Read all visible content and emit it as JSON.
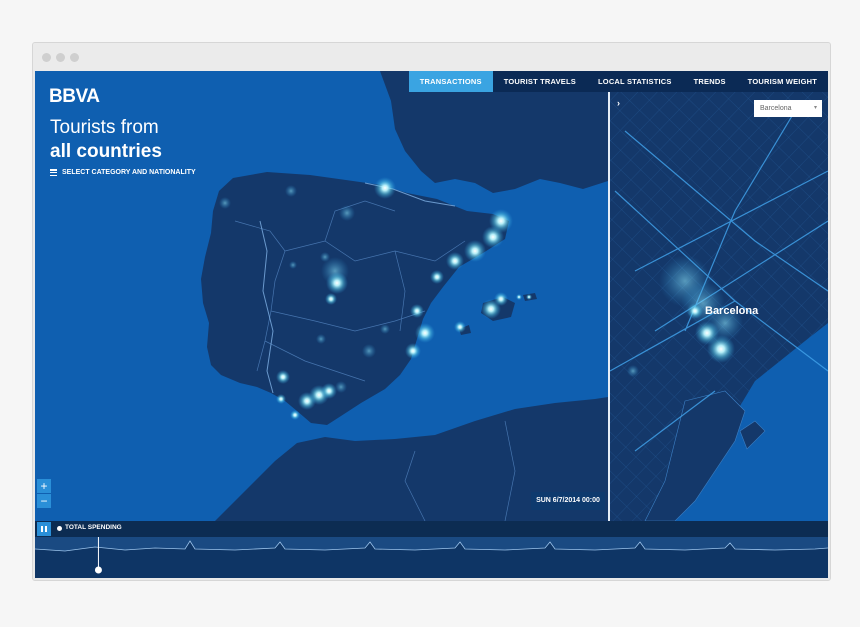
{
  "app": {
    "logo": "BBVA",
    "headline_light": "Tourists from",
    "headline_bold": "all countries",
    "category_selector": "SELECT CATEGORY AND NATIONALITY"
  },
  "nav": {
    "tabs": [
      {
        "label": "TRANSACTIONS",
        "active": true
      },
      {
        "label": "TOURIST TRAVELS",
        "active": false
      },
      {
        "label": "LOCAL STATISTICS",
        "active": false
      },
      {
        "label": "TRENDS",
        "active": false
      },
      {
        "label": "TOURISM WEIGHT",
        "active": false
      }
    ]
  },
  "map": {
    "zoom_in": "+",
    "zoom_out": "−",
    "timestamp": "SUN 6/7/2014 00:00"
  },
  "city_panel": {
    "selected_city": "Barcelona",
    "city_label": "Barcelona",
    "expand_icon": "chevron-right-icon"
  },
  "timeline": {
    "legend_label": "TOTAL SPENDING",
    "play_state_icon": "pause-icon",
    "progress": 0.08
  },
  "colors": {
    "sea": "#0f5fb0",
    "land": "#14386a",
    "accent": "#3aa4e2",
    "glow": "#9ef3ff"
  }
}
